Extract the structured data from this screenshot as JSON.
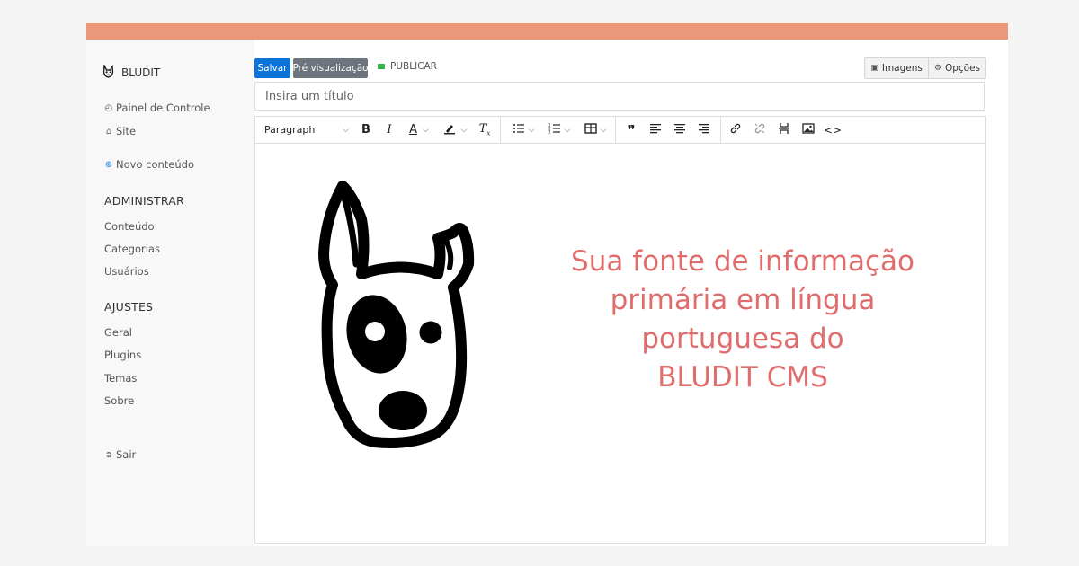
{
  "sidebar": {
    "brand": "BLUDIT",
    "links": {
      "dashboard": "Painel de Controle",
      "site": "Site",
      "new_content": "Novo conteúdo"
    },
    "admin_header": "ADMINISTRAR",
    "admin_items": [
      "Conteúdo",
      "Categorias",
      "Usuários"
    ],
    "settings_header": "AJUSTES",
    "settings_items": [
      "Geral",
      "Plugins",
      "Temas",
      "Sobre"
    ],
    "logout": "Sair"
  },
  "topbar": {
    "save_label": "Salvar",
    "preview_label": "Pré visualização",
    "publish_label": "PUBLICAR",
    "publish_status_color": "#2fb344",
    "images_label": "Imagens",
    "options_label": "Opções"
  },
  "title_field": {
    "placeholder": "Insira um título",
    "value": ""
  },
  "toolbar": {
    "format_select": "Paragraph",
    "buttons": [
      "bold",
      "italic",
      "text-color",
      "highlight",
      "clear-format",
      "bullet-list",
      "numbered-list",
      "table",
      "blockquote",
      "align-left",
      "align-center",
      "align-right",
      "link",
      "unlink",
      "page-break",
      "image",
      "code"
    ]
  },
  "content": {
    "tagline": [
      "Sua fonte de informação",
      "primária em língua",
      "portuguesa do",
      "BLUDIT CMS"
    ],
    "tagline_color": "#e06c6c"
  },
  "colors": {
    "accent": "#eb9779",
    "primary_button": "#0a74d9",
    "secondary_button": "#6c757d"
  }
}
